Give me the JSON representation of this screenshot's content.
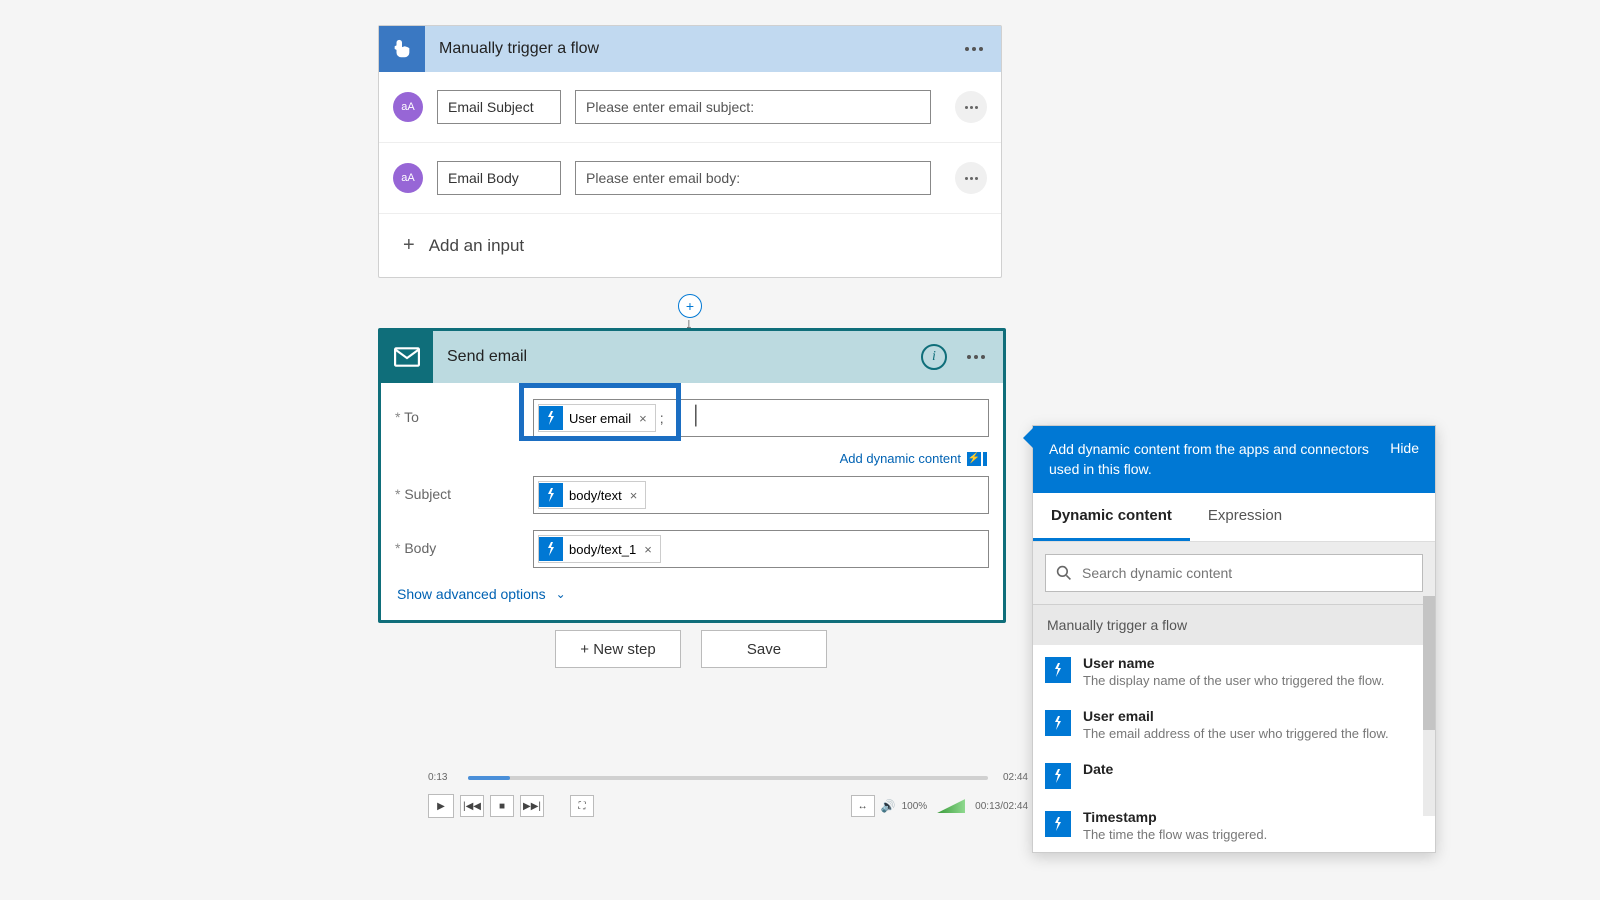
{
  "trigger": {
    "title": "Manually trigger a flow",
    "inputs": [
      {
        "name": "Email Subject",
        "prompt": "Please enter email subject:",
        "badge": "aA"
      },
      {
        "name": "Email Body",
        "prompt": "Please enter email body:",
        "badge": "aA"
      }
    ],
    "add_input": "Add an input"
  },
  "action": {
    "title": "Send email",
    "fields": {
      "to_label": "To",
      "to_token": "User email",
      "subject_label": "Subject",
      "subject_token": "body/text",
      "body_label": "Body",
      "body_token": "body/text_1"
    },
    "add_dynamic": "Add dynamic content",
    "advanced": "Show advanced options"
  },
  "buttons": {
    "new_step": "+ New step",
    "save": "Save"
  },
  "dyn": {
    "heading": "Add dynamic content from the apps and connectors used in this flow.",
    "hide": "Hide",
    "tabs": {
      "dynamic": "Dynamic content",
      "expression": "Expression"
    },
    "search_placeholder": "Search dynamic content",
    "group": "Manually trigger a flow",
    "items": [
      {
        "title": "User name",
        "desc": "The display name of the user who triggered the flow."
      },
      {
        "title": "User email",
        "desc": "The email address of the user who triggered the flow."
      },
      {
        "title": "Date",
        "desc": ""
      },
      {
        "title": "Timestamp",
        "desc": "The time the flow was triggered."
      }
    ]
  },
  "player": {
    "elapsed": "0:13",
    "total": "02:44",
    "combined": "00:13/02:44",
    "zoom": "100%"
  }
}
